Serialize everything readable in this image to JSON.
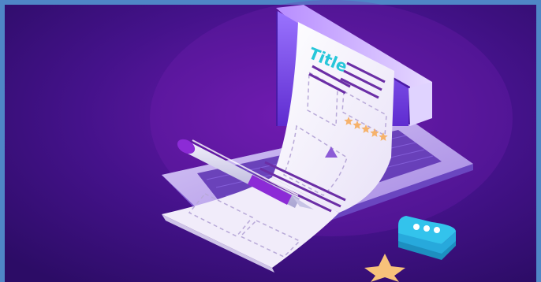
{
  "illustration": {
    "document_heading": "Title",
    "rating_stars": 5,
    "chat_bubble_dots": 3,
    "colors": {
      "frame": "#4f86c6",
      "background": "#3a0f78",
      "background_glow": "#7a1fb8",
      "laptop_body": "#c9b6f2",
      "screen_glow": "#a26bff",
      "paper": "#f4f1fb",
      "title_text": "#27c6d9",
      "text_lines": "#6b2ea6",
      "stars": "#f6b26b",
      "chat_bubble": "#33c3ec",
      "pen_body": "#cfcfe9",
      "pen_accent": "#8c2bd6",
      "gold_star": "#f7c27a"
    }
  }
}
